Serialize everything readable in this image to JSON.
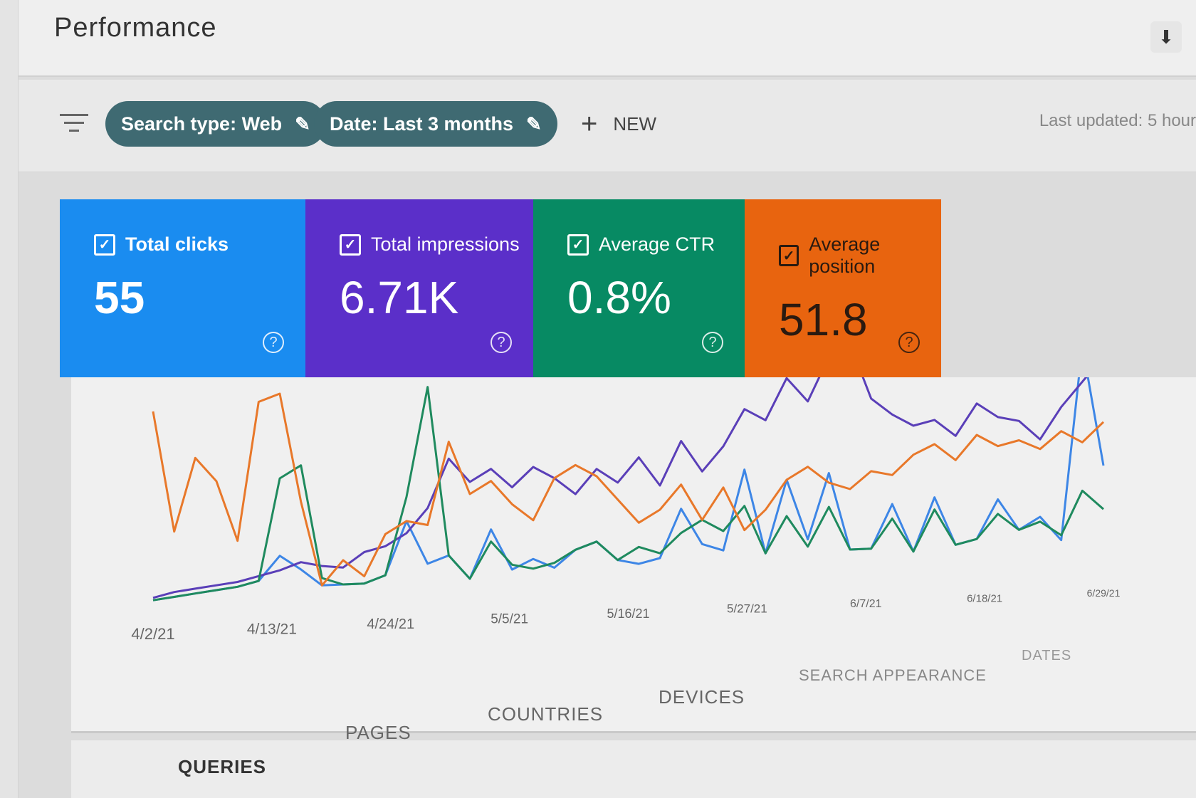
{
  "header": {
    "title": "Performance",
    "download_icon": "download-icon"
  },
  "filters": {
    "filter_icon": "filter-icon",
    "chips": [
      {
        "label": "Search type: Web",
        "icon": "pencil-icon"
      },
      {
        "label": "Date: Last 3 months",
        "icon": "pencil-icon"
      }
    ],
    "new_label": "NEW",
    "last_updated": "Last updated: 5 hour"
  },
  "cards": [
    {
      "label": "Total clicks",
      "value": "55",
      "color": "#1a8cf0",
      "text_color": "#ffffff",
      "checked": true
    },
    {
      "label": "Total impressions",
      "value": "6.71K",
      "color": "#5b2fc9",
      "text_color": "#ffffff",
      "checked": true
    },
    {
      "label": "Average CTR",
      "value": "0.8%",
      "color": "#078a63",
      "text_color": "#ffffff",
      "checked": true
    },
    {
      "label": "Average position",
      "value": "51.8",
      "color": "#e8640f",
      "text_color": "#2a1a10",
      "checked": true
    }
  ],
  "chart_data": {
    "type": "line",
    "title": "",
    "x_ticks": [
      "4/2/21",
      "4/13/21",
      "4/24/21",
      "5/5/21",
      "5/16/21",
      "5/27/21",
      "6/7/21",
      "6/18/21",
      "6/29/21"
    ],
    "x_range": [
      "4/2/21",
      "7/1/21"
    ],
    "y_axis": "hidden (relative scale per series)",
    "grid": false,
    "series": [
      {
        "name": "Total clicks",
        "color": "#3d86e6",
        "values": [
          2,
          3,
          4,
          5,
          6,
          8,
          18,
          12,
          5,
          5,
          5,
          8,
          30,
          12,
          15,
          5,
          25,
          8,
          12,
          8,
          15,
          18,
          10,
          8,
          10,
          30,
          15,
          12,
          45,
          10,
          40,
          15,
          42,
          10,
          10,
          28,
          8,
          30,
          10,
          12,
          28,
          15,
          20,
          10,
          90,
          40
        ]
      },
      {
        "name": "Total impressions",
        "color": "#5a3fb8",
        "values": [
          3,
          5,
          6,
          7,
          8,
          10,
          12,
          15,
          13,
          12,
          18,
          20,
          25,
          35,
          55,
          45,
          50,
          42,
          50,
          45,
          38,
          48,
          42,
          52,
          40,
          58,
          45,
          55,
          70,
          65,
          82,
          72,
          90,
          95,
          72,
          65,
          60,
          62,
          55,
          68,
          62,
          60,
          52,
          65,
          75,
          85
        ]
      },
      {
        "name": "Average CTR",
        "color": "#1f8a5e",
        "values": [
          2,
          3,
          4,
          5,
          6,
          8,
          50,
          55,
          8,
          5,
          5,
          8,
          40,
          85,
          15,
          5,
          20,
          10,
          8,
          10,
          15,
          18,
          10,
          15,
          12,
          20,
          25,
          20,
          30,
          10,
          25,
          12,
          28,
          10,
          10,
          22,
          8,
          25,
          10,
          12,
          22,
          15,
          18,
          12,
          30,
          22
        ]
      },
      {
        "name": "Average position",
        "color": "#e8782a",
        "values": [
          80,
          30,
          60,
          50,
          25,
          82,
          85,
          40,
          5,
          15,
          8,
          25,
          30,
          28,
          62,
          40,
          45,
          35,
          28,
          45,
          50,
          45,
          35,
          25,
          30,
          40,
          25,
          38,
          20,
          28,
          40,
          45,
          38,
          35,
          42,
          40,
          48,
          52,
          45,
          55,
          50,
          52,
          48,
          55,
          50,
          58
        ]
      }
    ]
  },
  "tabs": [
    "QUERIES",
    "PAGES",
    "COUNTRIES",
    "DEVICES",
    "SEARCH APPEARANCE",
    "DATES"
  ]
}
